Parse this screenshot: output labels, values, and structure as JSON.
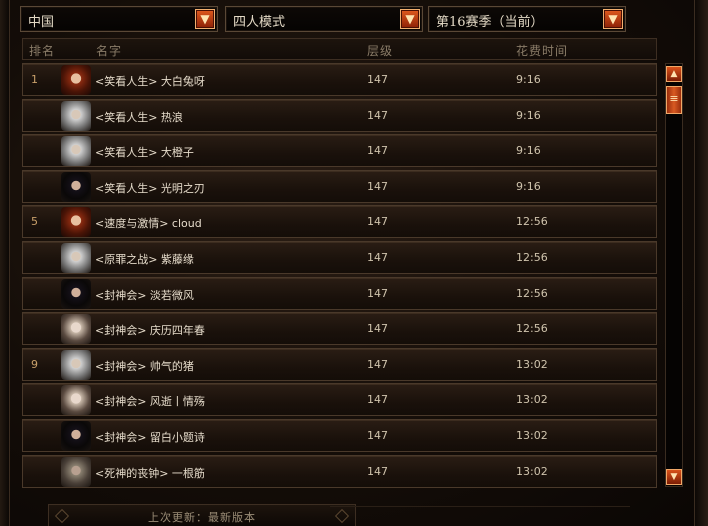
{
  "filters": {
    "region": "中国",
    "mode": "四人模式",
    "season": "第16赛季（当前）"
  },
  "columns": {
    "rank": "排名",
    "name": "名字",
    "tier": "层级",
    "time": "花费时间"
  },
  "rows": [
    {
      "rank": "1",
      "name": "<笑看人生> 大白兔呀",
      "tier": "147",
      "time": "9:16",
      "avatar": "red-hair"
    },
    {
      "rank": "",
      "name": "<笑看人生> 热浪",
      "tier": "147",
      "time": "9:16",
      "avatar": "white-hair"
    },
    {
      "rank": "",
      "name": "<笑看人生> 大橙子",
      "tier": "147",
      "time": "9:16",
      "avatar": "white-hair"
    },
    {
      "rank": "",
      "name": "<笑看人生> 光明之刃",
      "tier": "147",
      "time": "9:16",
      "avatar": "dark-hair"
    },
    {
      "rank": "5",
      "name": "<速度与激情> cloud",
      "tier": "147",
      "time": "12:56",
      "avatar": "red-hair"
    },
    {
      "rank": "",
      "name": "<原罪之战> 紫藤缘",
      "tier": "147",
      "time": "12:56",
      "avatar": "white-hair"
    },
    {
      "rank": "",
      "name": "<封神会> 淡若微风",
      "tier": "147",
      "time": "12:56",
      "avatar": "dark-hair"
    },
    {
      "rank": "",
      "name": "<封神会> 庆历四年春",
      "tier": "147",
      "time": "12:56",
      "avatar": "pale"
    },
    {
      "rank": "9",
      "name": "<封神会> 帅气的猪",
      "tier": "147",
      "time": "13:02",
      "avatar": "white-hair"
    },
    {
      "rank": "",
      "name": "<封神会> 风逝丨情殇",
      "tier": "147",
      "time": "13:02",
      "avatar": "pale"
    },
    {
      "rank": "",
      "name": "<封神会> 留白小题诗",
      "tier": "147",
      "time": "13:02",
      "avatar": "dark-hair"
    },
    {
      "rank": "",
      "name": "<死神的丧钟> 一根筋",
      "tier": "147",
      "time": "13:02",
      "avatar": "grey-hair"
    }
  ],
  "footer": {
    "last_update": "上次更新：最新版本"
  },
  "icons": {
    "dropdown": "chevron-down-icon",
    "scroll_up": "arrow-up-icon",
    "scroll_down": "arrow-down-icon",
    "scroll_thumb": "grip-icon"
  },
  "colors": {
    "accent": "#d8521a",
    "rank_text": "#c9a06a",
    "frame_border": "#4a392a"
  }
}
